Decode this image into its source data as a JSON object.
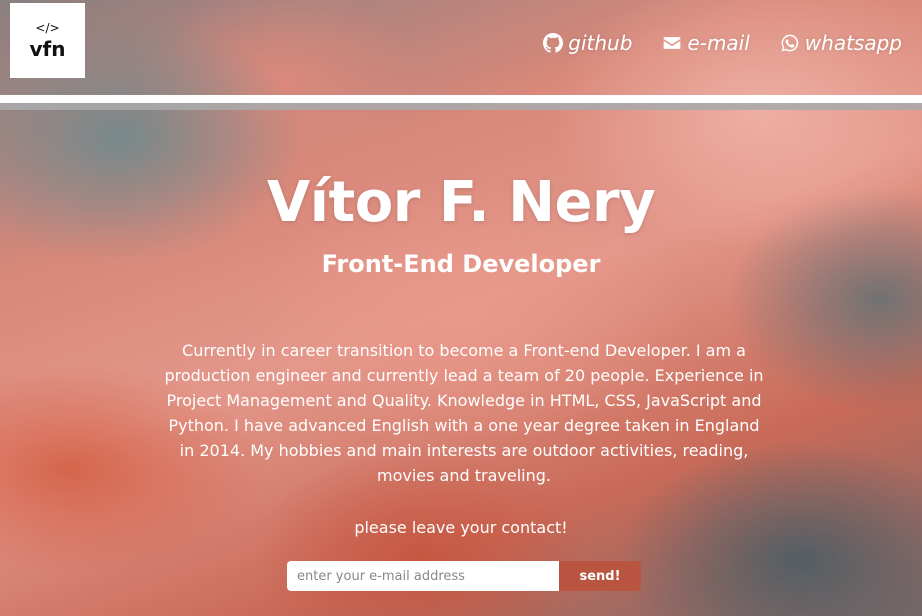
{
  "header": {
    "logo": {
      "code": "</>",
      "text": "vfn"
    },
    "nav": [
      {
        "label": "github",
        "icon": "github-icon"
      },
      {
        "label": "e-mail",
        "icon": "envelope-icon"
      },
      {
        "label": "whatsapp",
        "icon": "whatsapp-icon"
      }
    ]
  },
  "hero": {
    "name": "Vítor F. Nery",
    "role": "Front-End Developer",
    "bio": "Currently in career transition to become a Front-end Developer. I am a production engineer and currently lead a team of 20 people. Experience in Project Management and Quality. Knowledge in HTML, CSS, JavaScript and Python. I have advanced English with a one year degree taken in England in 2014. My hobbies and main interests are outdoor activities, reading, movies and traveling.",
    "cta": "please leave your contact!"
  },
  "form": {
    "email_placeholder": "enter your e-mail address",
    "email_value": "",
    "send_label": "send!"
  },
  "colors": {
    "button": "#b8543f",
    "divider": "#ffffff",
    "text": "#ffffff"
  }
}
